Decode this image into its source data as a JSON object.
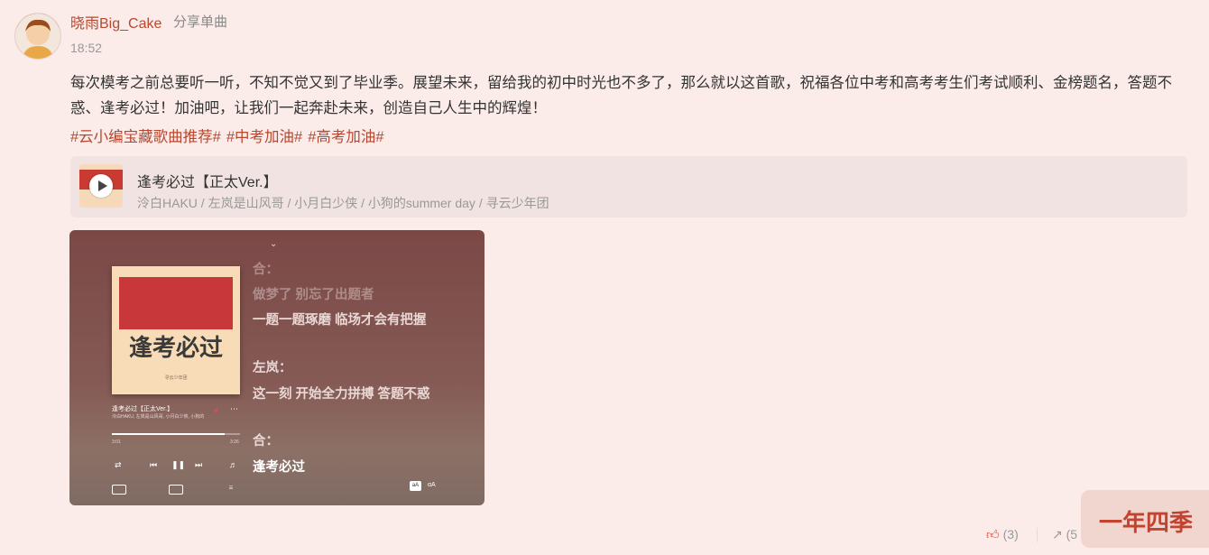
{
  "user": {
    "name": "晓雨Big_Cake",
    "action": "分享单曲",
    "time": "18:52"
  },
  "post": {
    "text": "每次模考之前总要听一听，不知不觉又到了毕业季。展望未来，留给我的初中时光也不多了，那么就以这首歌，祝福各位中考和高考考生们考试顺利、金榜题名，答题不惑、逢考必过！加油吧，让我们一起奔赴未来，创造自己人生中的辉煌！",
    "hashtags": [
      "#云小编宝藏歌曲推荐#",
      "#中考加油#",
      "#高考加油#"
    ]
  },
  "song": {
    "title": "逢考必过【正太Ver.】",
    "artists": "泠白HAKU / 左岚是山风哥 / 小月白少侠 / 小狗的summer day / 寻云少年团"
  },
  "player": {
    "art_text": "逢考必过",
    "art_small": "寻云少年团",
    "mini_title": "逢考必过【正太Ver.】",
    "mini_artists": "泠白HAKU, 左岚是山风哥, 小月白少侠, 小狗的",
    "time_elapsed": "3:01",
    "time_total": "3:26",
    "progress": 0.88,
    "lyrics": [
      {
        "text": "合：",
        "state": "faint"
      },
      {
        "text": "做梦了 别忘了出题者",
        "state": "faint"
      },
      {
        "text": "一题一题琢磨 临场才会有把握",
        "state": "normal"
      },
      {
        "text": "左岚：",
        "state": "normal"
      },
      {
        "text": "这一刻 开始全力拼搏 答题不惑",
        "state": "normal"
      },
      {
        "text": "合：",
        "state": "normal"
      },
      {
        "text": "逢考必过",
        "state": "active"
      }
    ]
  },
  "footer": {
    "likes": "(3)",
    "shares": "(5"
  },
  "watermark": "一年四季",
  "colors": {
    "accent": "#b8472f",
    "background": "#fbecea",
    "like": "#e0443a"
  }
}
